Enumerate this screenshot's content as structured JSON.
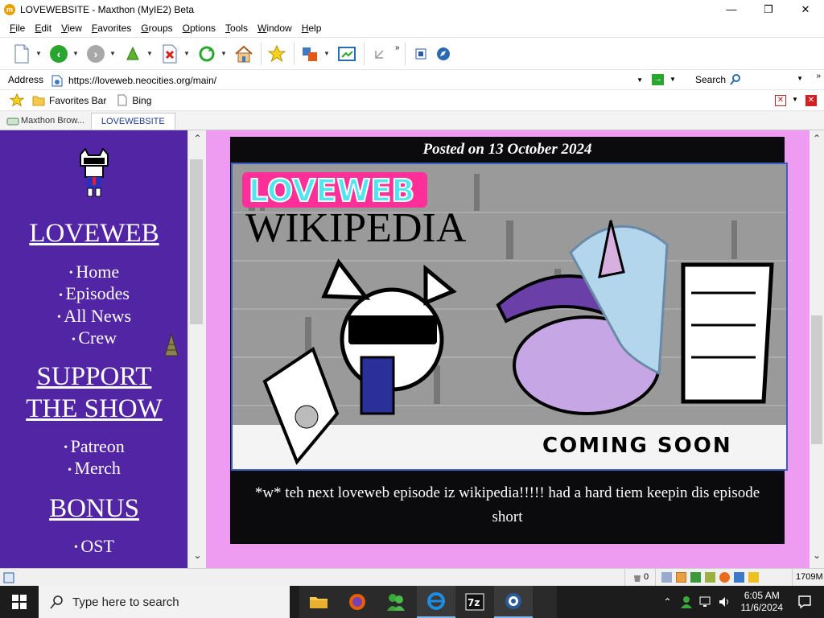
{
  "window": {
    "title": "LOVEWEBSITE - Maxthon (MyIE2) Beta",
    "app_icon_letter": "m",
    "minimize": "—",
    "maximize": "❐",
    "close": "✕"
  },
  "menu": [
    "File",
    "Edit",
    "View",
    "Favorites",
    "Groups",
    "Options",
    "Tools",
    "Window",
    "Help"
  ],
  "toolbar": {
    "overflow": "»"
  },
  "address": {
    "label": "Address",
    "url": "https://loveweb.neocities.org/main/",
    "search_label": "Search",
    "overflow": "»"
  },
  "favorites": {
    "items": [
      {
        "label": "Favorites Bar"
      },
      {
        "label": "Bing"
      }
    ]
  },
  "tabs": [
    {
      "label": "Maxthon Brow...",
      "active": false
    },
    {
      "label": "LOVEWEBSITE",
      "active": true
    }
  ],
  "sidebar": {
    "heading_main": "LOVEWEBSITE",
    "heading_main_display": "LOVEWEB",
    "nav": [
      "Home",
      "Episodes",
      "All News",
      "Crew"
    ],
    "support_heading_line1": "SUPPORT",
    "support_heading_line2": "THE SHOW",
    "support_links": [
      "Patreon",
      "Merch"
    ],
    "bonus_heading": "BONUS",
    "bonus_links": [
      "OST"
    ]
  },
  "post": {
    "date": "Posted on 13 October 2024",
    "banner_logo": "LOVEWEB",
    "banner_title": "WIKIPEDIA",
    "banner_tag": "COMING SOON",
    "body": "*w* teh next loveweb episode iz wikipedia!!!!! had a hard tiem keepin dis episode short"
  },
  "statusbar": {
    "trash_count": "0",
    "memory": "1709M"
  },
  "taskbar": {
    "search_placeholder": "Type here to search",
    "time": "6:05 AM",
    "date": "11/6/2024"
  },
  "colors": {
    "page_bg": "#ee9cf2",
    "sidebar_bg": "#5225a4",
    "content_bg": "#0b0b0e",
    "banner_border": "#3b5fc0",
    "logo_pink": "#ff2f9a",
    "logo_cyan": "#4fe6f0"
  }
}
